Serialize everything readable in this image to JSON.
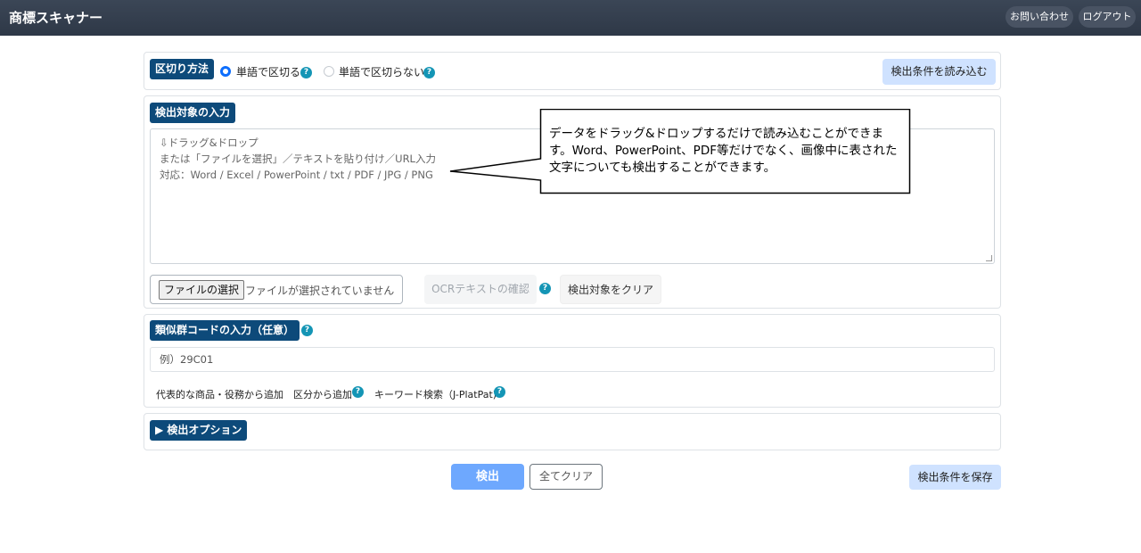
{
  "app": {
    "title": "商標スキャナー"
  },
  "nav": {
    "contact": "お問い合わせ",
    "logout": "ログアウト"
  },
  "split": {
    "tag": "区切り方法",
    "option_word": "単語で区切る",
    "option_noword": "単語で区切らない",
    "selected": "単語で区切る",
    "load_button": "検出条件を読み込む",
    "help": "?"
  },
  "target": {
    "tag": "検出対象の入力",
    "placeholder": "⇩ドラッグ&ドロップ\nまたは「ファイルを選択」／テキストを貼り付け／URL入力\n対応：Word / Excel / PowerPoint / txt / PDF / JPG / PNG",
    "file_button": "ファイルの選択",
    "file_status": "ファイルが選択されていません",
    "ocr_button": "OCRテキストの確認",
    "clear_button": "検出対象をクリア"
  },
  "callout": {
    "text": "データをドラッグ&ドロップするだけで読み込むことができます。Word、PowerPoint、PDF等だけでなく、画像中に表された文字についても検出することができます。"
  },
  "similar": {
    "tag": "類似群コードの入力（任意）",
    "placeholder": "例）29C01",
    "link_products": "代表的な商品・役務から追加",
    "link_class": "区分から追加",
    "link_keyword": "キーワード検索（J-PlatPat)"
  },
  "options": {
    "tag": "▶ 検出オプション"
  },
  "footer": {
    "search": "検出",
    "clear_all": "全てクリア",
    "save": "検出条件を保存"
  },
  "colors": {
    "navbar": "#343a40",
    "tag": "#0d4a7a",
    "primary": "#0d6efd",
    "help": "#1495b5",
    "soft": "#cfe2ff"
  }
}
